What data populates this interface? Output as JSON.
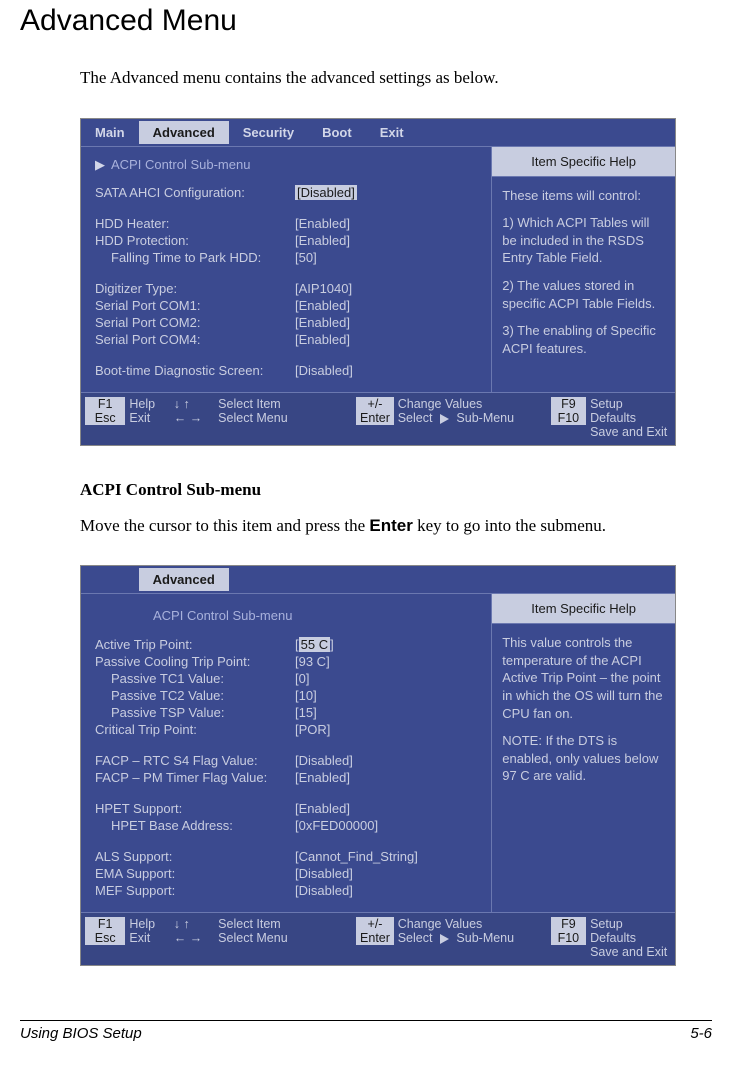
{
  "page_title": "Advanced Menu",
  "intro_text": "The Advanced menu contains the advanced settings as below.",
  "section_heading": "ACPI Control Sub-menu",
  "section_text_pre": "Move the cursor to this item and press the ",
  "section_text_key": "Enter",
  "section_text_post": " key to go into the submenu.",
  "footer_label": "Using BIOS Setup",
  "footer_page": "5-6",
  "bios1": {
    "tabs": [
      "Main",
      "Advanced",
      "Security",
      "Boot",
      "Exit"
    ],
    "active_tab": "Advanced",
    "submenu_pointer": "ACPI Control Sub-menu",
    "rows": [
      {
        "label": "SATA AHCI Configuration:",
        "value": "[Disabled]",
        "highlighted": true,
        "indent": false
      },
      {
        "gap": true
      },
      {
        "label": "HDD Heater:",
        "value": "[Enabled]",
        "indent": false
      },
      {
        "label": "HDD Protection:",
        "value": "[Enabled]",
        "indent": false
      },
      {
        "label": "Falling Time to Park HDD:",
        "value": "[50]",
        "indent": true
      },
      {
        "gap": true
      },
      {
        "label": "Digitizer Type:",
        "value": "[AIP1040]",
        "indent": false
      },
      {
        "label": "Serial Port COM1:",
        "value": "[Enabled]",
        "indent": false
      },
      {
        "label": "Serial Port COM2:",
        "value": "[Enabled]",
        "indent": false
      },
      {
        "label": "Serial Port COM4:",
        "value": "[Enabled]",
        "indent": false
      },
      {
        "gap": true
      },
      {
        "label": "Boot-time Diagnostic Screen:",
        "value": "[Disabled]",
        "indent": false
      }
    ],
    "help_header": "Item Specific Help",
    "help_lines": [
      "These items will control:",
      "",
      "1) Which ACPI Tables will be included in the RSDS Entry Table Field.",
      "",
      "2) The values stored in specific ACPI Table Fields.",
      "",
      "3) The enabling of Specific ACPI features."
    ]
  },
  "bios2": {
    "active_tab": "Advanced",
    "subtitle": "ACPI Control Sub-menu",
    "rows": [
      {
        "label": "Active Trip Point:",
        "value_pre": "[",
        "value_mid": "55 C",
        "value_post": "]",
        "highlighted": true,
        "indent": false
      },
      {
        "label": "Passive Cooling Trip Point:",
        "value": "[93 C]",
        "indent": false
      },
      {
        "label": "Passive TC1 Value:",
        "value": "[0]",
        "indent": true
      },
      {
        "label": "Passive TC2 Value:",
        "value": "[10]",
        "indent": true
      },
      {
        "label": "Passive TSP Value:",
        "value": "[15]",
        "indent": true
      },
      {
        "label": "Critical Trip Point:",
        "value": "[POR]",
        "indent": false
      },
      {
        "gap": true
      },
      {
        "label": "FACP – RTC S4 Flag Value:",
        "value": "[Disabled]",
        "indent": false
      },
      {
        "label": "FACP – PM Timer Flag Value:",
        "value": "[Enabled]",
        "indent": false
      },
      {
        "gap": true
      },
      {
        "label": "HPET Support:",
        "value": "[Enabled]",
        "indent": false
      },
      {
        "label": "HPET Base Address:",
        "value": "[0xFED00000]",
        "indent": true
      },
      {
        "gap": true
      },
      {
        "label": "ALS Support:",
        "value": "[Cannot_Find_String]",
        "indent": false
      },
      {
        "label": "EMA Support:",
        "value": "[Disabled]",
        "indent": false
      },
      {
        "label": "MEF Support:",
        "value": "[Disabled]",
        "indent": false
      }
    ],
    "help_header": "Item Specific Help",
    "help_lines": [
      "This value controls the temperature of the ACPI Active Trip Point – the point in which the OS will turn the CPU fan on.",
      "",
      "NOTE: If the DTS is enabled, only values below 97 C are valid."
    ]
  },
  "keyhelp": {
    "f1": "F1",
    "help": "Help",
    "esc": "Esc",
    "exit": "Exit",
    "updown": "↓ ↑",
    "select_item": "Select Item",
    "leftright": "← →",
    "select_menu": "Select Menu",
    "plusminus": "+/-",
    "change_values": "Change Values",
    "enter": "Enter",
    "select_sub": "Select",
    "sub_menu": " Sub-Menu",
    "f9": "F9",
    "setup_defaults": "Setup Defaults",
    "f10": "F10",
    "save_exit": "Save and Exit"
  }
}
